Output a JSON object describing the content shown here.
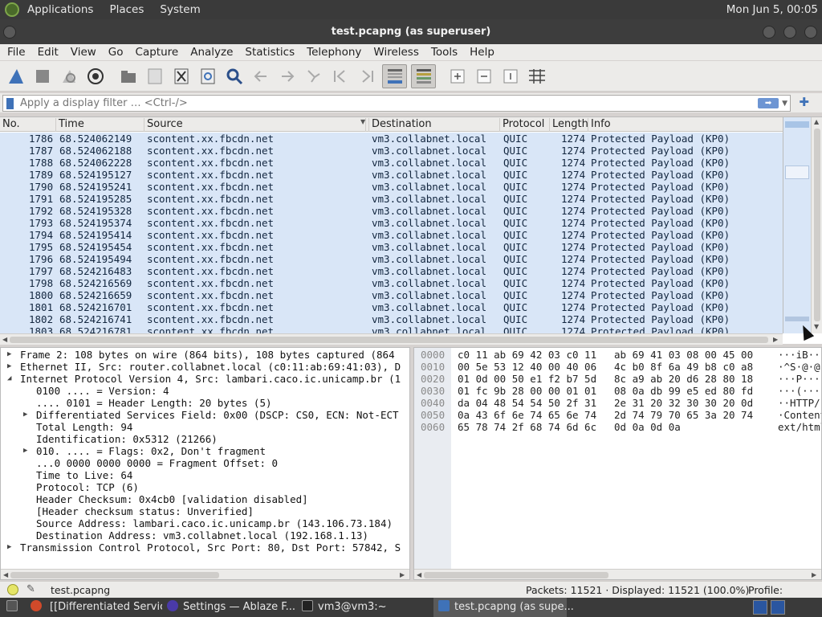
{
  "top_panel": {
    "menus": [
      "Applications",
      "Places",
      "System"
    ],
    "clock": "Mon Jun  5, 00:05"
  },
  "window": {
    "title": "test.pcapng (as superuser)"
  },
  "menubar": [
    "File",
    "Edit",
    "View",
    "Go",
    "Capture",
    "Analyze",
    "Statistics",
    "Telephony",
    "Wireless",
    "Tools",
    "Help"
  ],
  "toolbar": {
    "icons": [
      "start-capture-icon",
      "stop-capture-icon",
      "restart-capture-icon",
      "capture-options-icon",
      "open-file-icon",
      "save-file-icon",
      "close-file-icon",
      "reload-file-icon",
      "find-packet-icon",
      "go-back-icon",
      "go-forward-icon",
      "go-to-packet-icon",
      "go-first-icon",
      "go-last-icon",
      "autoscroll-icon",
      "colorize-icon",
      "zoom-in-icon",
      "zoom-out-icon",
      "normal-size-icon",
      "resize-columns-icon"
    ]
  },
  "filter": {
    "placeholder": "Apply a display filter … <Ctrl-/>"
  },
  "packet_list": {
    "columns": [
      "No.",
      "Time",
      "Source",
      "Destination",
      "Protocol",
      "Length",
      "Info"
    ],
    "rows": [
      [
        "1786",
        "68.524062149",
        "scontent.xx.fbcdn.net",
        "vm3.collabnet.local",
        "QUIC",
        "1274",
        "Protected Payload (KP0)"
      ],
      [
        "1787",
        "68.524062188",
        "scontent.xx.fbcdn.net",
        "vm3.collabnet.local",
        "QUIC",
        "1274",
        "Protected Payload (KP0)"
      ],
      [
        "1788",
        "68.524062228",
        "scontent.xx.fbcdn.net",
        "vm3.collabnet.local",
        "QUIC",
        "1274",
        "Protected Payload (KP0)"
      ],
      [
        "1789",
        "68.524195127",
        "scontent.xx.fbcdn.net",
        "vm3.collabnet.local",
        "QUIC",
        "1274",
        "Protected Payload (KP0)"
      ],
      [
        "1790",
        "68.524195241",
        "scontent.xx.fbcdn.net",
        "vm3.collabnet.local",
        "QUIC",
        "1274",
        "Protected Payload (KP0)"
      ],
      [
        "1791",
        "68.524195285",
        "scontent.xx.fbcdn.net",
        "vm3.collabnet.local",
        "QUIC",
        "1274",
        "Protected Payload (KP0)"
      ],
      [
        "1792",
        "68.524195328",
        "scontent.xx.fbcdn.net",
        "vm3.collabnet.local",
        "QUIC",
        "1274",
        "Protected Payload (KP0)"
      ],
      [
        "1793",
        "68.524195374",
        "scontent.xx.fbcdn.net",
        "vm3.collabnet.local",
        "QUIC",
        "1274",
        "Protected Payload (KP0)"
      ],
      [
        "1794",
        "68.524195414",
        "scontent.xx.fbcdn.net",
        "vm3.collabnet.local",
        "QUIC",
        "1274",
        "Protected Payload (KP0)"
      ],
      [
        "1795",
        "68.524195454",
        "scontent.xx.fbcdn.net",
        "vm3.collabnet.local",
        "QUIC",
        "1274",
        "Protected Payload (KP0)"
      ],
      [
        "1796",
        "68.524195494",
        "scontent.xx.fbcdn.net",
        "vm3.collabnet.local",
        "QUIC",
        "1274",
        "Protected Payload (KP0)"
      ],
      [
        "1797",
        "68.524216483",
        "scontent.xx.fbcdn.net",
        "vm3.collabnet.local",
        "QUIC",
        "1274",
        "Protected Payload (KP0)"
      ],
      [
        "1798",
        "68.524216569",
        "scontent.xx.fbcdn.net",
        "vm3.collabnet.local",
        "QUIC",
        "1274",
        "Protected Payload (KP0)"
      ],
      [
        "1800",
        "68.524216659",
        "scontent.xx.fbcdn.net",
        "vm3.collabnet.local",
        "QUIC",
        "1274",
        "Protected Payload (KP0)"
      ],
      [
        "1801",
        "68.524216701",
        "scontent.xx.fbcdn.net",
        "vm3.collabnet.local",
        "QUIC",
        "1274",
        "Protected Payload (KP0)"
      ],
      [
        "1802",
        "68.524216741",
        "scontent.xx.fbcdn.net",
        "vm3.collabnet.local",
        "QUIC",
        "1274",
        "Protected Payload (KP0)"
      ],
      [
        "1803",
        "68.524216781",
        "scontent.xx.fbcdn.net",
        "vm3.collabnet.local",
        "QUIC",
        "1274",
        "Protected Payload (KP0)"
      ]
    ]
  },
  "details": [
    {
      "text": "Frame 2: 108 bytes on wire (864 bits), 108 bytes captured (864",
      "expander": "collapsed"
    },
    {
      "text": "Ethernet II, Src: router.collabnet.local (c0:11:ab:69:41:03), D",
      "expander": "collapsed"
    },
    {
      "text": "Internet Protocol Version 4, Src: lambari.caco.ic.unicamp.br (1",
      "expander": "expanded"
    },
    {
      "text": "0100 .... = Version: 4",
      "expander": "none"
    },
    {
      "text": ".... 0101 = Header Length: 20 bytes (5)",
      "expander": "none"
    },
    {
      "text": "Differentiated Services Field: 0x00 (DSCP: CS0, ECN: Not-ECT",
      "expander": "collapsed"
    },
    {
      "text": "Total Length: 94",
      "expander": "none"
    },
    {
      "text": "Identification: 0x5312 (21266)",
      "expander": "none"
    },
    {
      "text": "010. .... = Flags: 0x2, Don't fragment",
      "expander": "collapsed"
    },
    {
      "text": "...0 0000 0000 0000 = Fragment Offset: 0",
      "expander": "none"
    },
    {
      "text": "Time to Live: 64",
      "expander": "none"
    },
    {
      "text": "Protocol: TCP (6)",
      "expander": "none"
    },
    {
      "text": "Header Checksum: 0x4cb0 [validation disabled]",
      "expander": "none"
    },
    {
      "text": "[Header checksum status: Unverified]",
      "expander": "none"
    },
    {
      "text": "Source Address: lambari.caco.ic.unicamp.br (143.106.73.184)",
      "expander": "none"
    },
    {
      "text": "Destination Address: vm3.collabnet.local (192.168.1.13)",
      "expander": "none"
    },
    {
      "text": "Transmission Control Protocol, Src Port: 80, Dst Port: 57842, S",
      "expander": "collapsed"
    }
  ],
  "bytes": [
    {
      "offset": "0000",
      "hex1": "c0 11 ab 69 42 03 c0 11",
      "hex2": "ab 69 41 03 08 00 45 00",
      "ascii": "···iB···"
    },
    {
      "offset": "0010",
      "hex1": "00 5e 53 12 40 00 40 06",
      "hex2": "4c b0 8f 6a 49 b8 c0 a8",
      "ascii": "·^S·@·@·"
    },
    {
      "offset": "0020",
      "hex1": "01 0d 00 50 e1 f2 b7 5d",
      "hex2": "8c a9 ab 20 d6 28 80 18",
      "ascii": "···P···]"
    },
    {
      "offset": "0030",
      "hex1": "01 fc 9b 28 00 00 01 01",
      "hex2": "08 0a db 99 e5 ed 80 fd",
      "ascii": "···(····"
    },
    {
      "offset": "0040",
      "hex1": "da 04 48 54 54 50 2f 31",
      "hex2": "2e 31 20 32 30 30 20 0d",
      "ascii": "··HTTP/1"
    },
    {
      "offset": "0050",
      "hex1": "0a 43 6f 6e 74 65 6e 74",
      "hex2": "2d 74 79 70 65 3a 20 74",
      "ascii": "·Content"
    },
    {
      "offset": "0060",
      "hex1": "65 78 74 2f 68 74 6d 6c",
      "hex2": "0d 0a 0d 0a",
      "ascii": "ext/html"
    }
  ],
  "status": {
    "file": "test.pcapng",
    "packets": "Packets: 11521 · Displayed: 11521 (100.0%)",
    "profile": "Profile: Default"
  },
  "taskbar": {
    "items": [
      "[[Differentiated Services]M...",
      "Settings — Ablaze F...",
      "vm3@vm3:~",
      "test.pcapng (as supe..."
    ]
  },
  "colors": {
    "row_bg": "#d9e6f7",
    "row_fg": "#12263f",
    "accent": "#3f72b8"
  }
}
